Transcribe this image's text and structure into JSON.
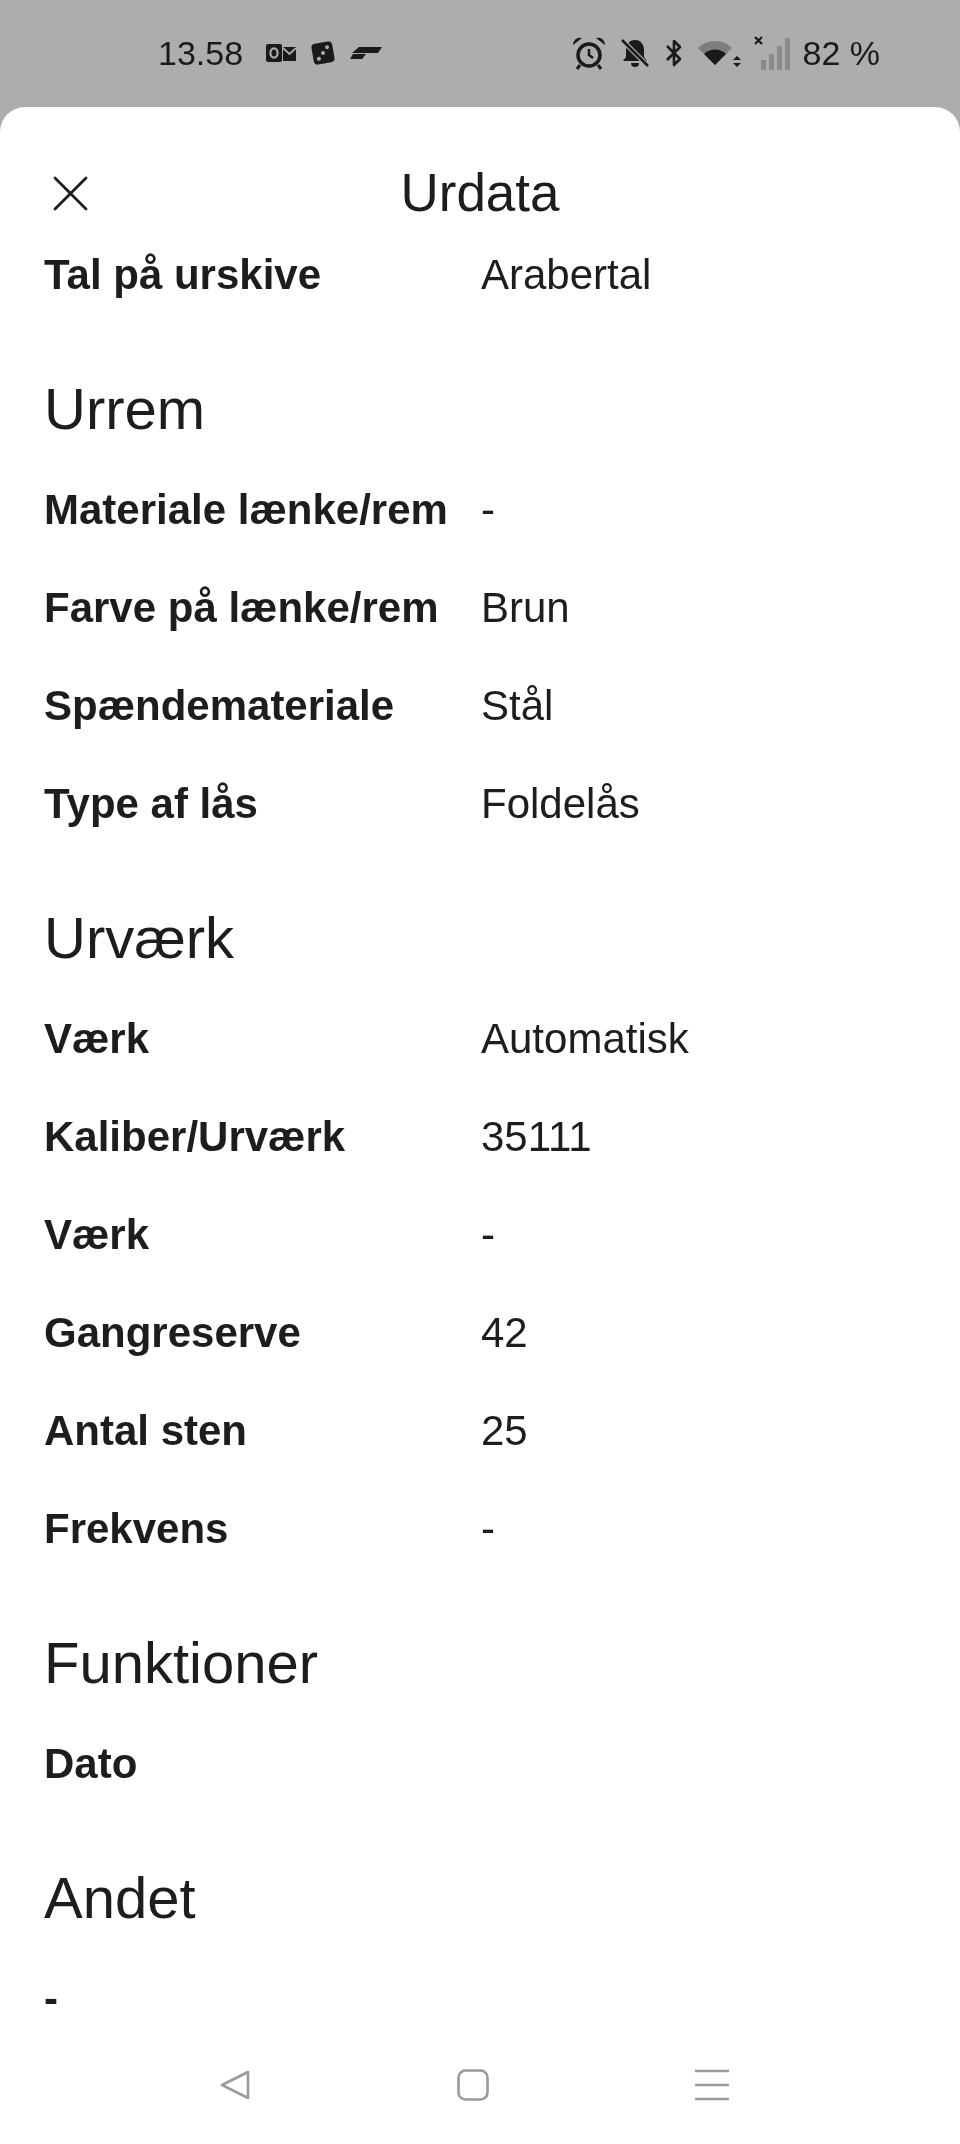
{
  "status_bar": {
    "time": "13.58",
    "battery": "82 %"
  },
  "header": {
    "title": "Urdata"
  },
  "cut_off_row": {
    "label": "Tal på urskive",
    "value": "Arabertal"
  },
  "sections": [
    {
      "heading": "Urrem",
      "rows": [
        {
          "label": "Materiale lænke/rem",
          "value": "-"
        },
        {
          "label": "Farve på lænke/rem",
          "value": "Brun"
        },
        {
          "label": "Spændemateriale",
          "value": "Stål"
        },
        {
          "label": "Type af lås",
          "value": "Foldelås"
        }
      ]
    },
    {
      "heading": "Urværk",
      "rows": [
        {
          "label": "Værk",
          "value": "Automatisk"
        },
        {
          "label": "Kaliber/Urværk",
          "value": "35111"
        },
        {
          "label": "Værk",
          "value": "-"
        },
        {
          "label": "Gangreserve",
          "value": "42"
        },
        {
          "label": "Antal sten",
          "value": "25"
        },
        {
          "label": "Frekvens",
          "value": "-"
        }
      ]
    },
    {
      "heading": "Funktioner",
      "rows": [
        {
          "label": "Dato"
        }
      ]
    },
    {
      "heading": "Andet",
      "rows": [
        {
          "label": "-"
        }
      ]
    }
  ]
}
